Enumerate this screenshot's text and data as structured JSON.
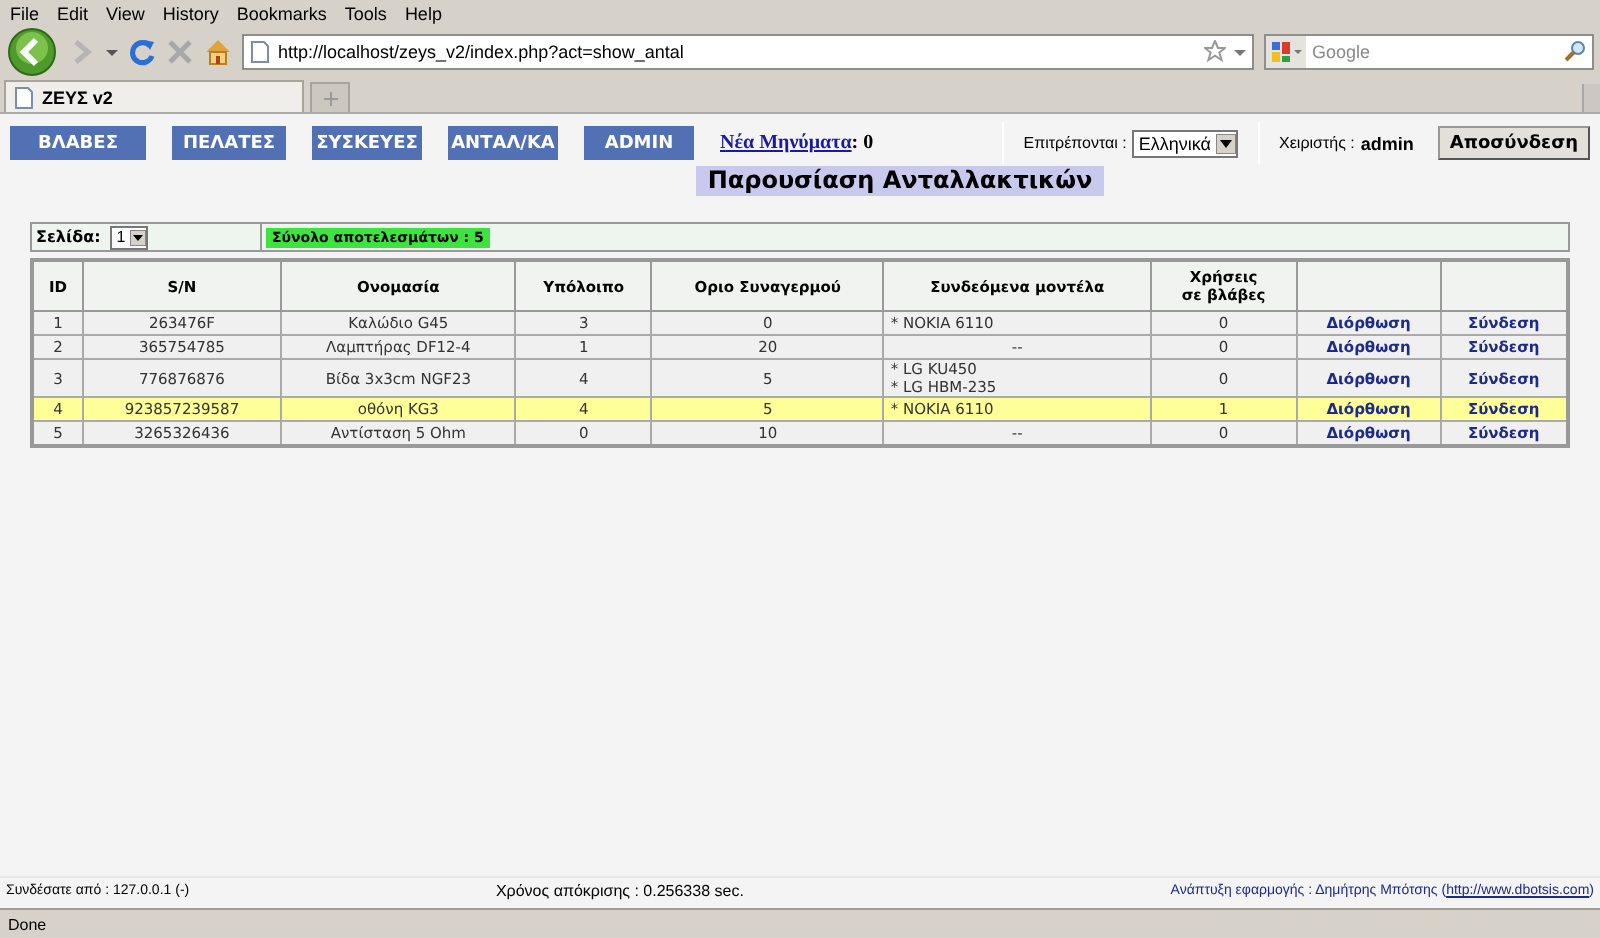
{
  "menu_bar": [
    "File",
    "Edit",
    "View",
    "History",
    "Bookmarks",
    "Tools",
    "Help"
  ],
  "address_bar": {
    "value": "http://localhost/zeys_v2/index.php?act=show_antal"
  },
  "search_box": {
    "placeholder": "Google"
  },
  "tabs": [
    {
      "label": "ΖΕΥΣ v2",
      "selected": true
    }
  ],
  "nav_buttons": [
    {
      "label": "ΒΛΑΒΕΣ"
    },
    {
      "label": "ΠΕΛΑΤΕΣ"
    },
    {
      "label": "ΣΥΣΚΕΥΕΣ"
    },
    {
      "label": "ΑΝΤΑΛ/ΚΑ"
    },
    {
      "label": "ADMIN"
    }
  ],
  "messages": {
    "link": "Νέα Μηνύματα",
    "count": ": 0"
  },
  "language": {
    "label": "Επιτρέπονται :",
    "value": "Ελληνικά"
  },
  "user": {
    "label": "Χειριστής :",
    "name": "admin"
  },
  "logout_button": "Αποσύνδεση",
  "page_title": "Παρουσίαση Ανταλλακτικών",
  "pager": {
    "label": "Σελίδα:",
    "value": "1"
  },
  "results_total": "Σύνολο αποτελεσμάτων : 5",
  "table": {
    "columns": [
      "ID",
      "S/N",
      "Ονομασία",
      "Υπόλοιπο",
      "Οριο Συναγερμού",
      "Συνδεόμενα μοντέλα",
      "Χρήσεις σε βλάβες"
    ],
    "rows": [
      {
        "id": "1",
        "sn": "263476F",
        "name": "Καλώδιο G45",
        "stock": "3",
        "alarm": "0",
        "models": [
          "* NOKIA 6110"
        ],
        "uses": "0",
        "edit": "Διόρθωση",
        "link": "Σύνδεση",
        "selected": false
      },
      {
        "id": "2",
        "sn": "365754785",
        "name": "Λαμπτήρας DF12-4",
        "stock": "1",
        "alarm": "20",
        "models": "--",
        "uses": "0",
        "edit": "Διόρθωση",
        "link": "Σύνδεση",
        "selected": false
      },
      {
        "id": "3",
        "sn": "776876876",
        "name": "Βίδα 3x3cm NGF23",
        "stock": "4",
        "alarm": "5",
        "models": [
          "* LG KU450",
          "* LG HBM-235"
        ],
        "uses": "0",
        "edit": "Διόρθωση",
        "link": "Σύνδεση",
        "selected": false
      },
      {
        "id": "4",
        "sn": "923857239587",
        "name": "οθόνη KG3",
        "stock": "4",
        "alarm": "5",
        "models": [
          "* NOKIA 6110"
        ],
        "uses": "1",
        "edit": "Διόρθωση",
        "link": "Σύνδεση",
        "selected": true
      },
      {
        "id": "5",
        "sn": "3265326436",
        "name": "Αντίσταση 5 Ohm",
        "stock": "0",
        "alarm": "10",
        "models": "--",
        "uses": "0",
        "edit": "Διόρθωση",
        "link": "Σύνδεση",
        "selected": false
      }
    ]
  },
  "footer": {
    "connection": "Συνδέσατε από : 127.0.0.1 (-)",
    "response_time": "Χρόνος απόκρισης : 0.256338 sec.",
    "credit": "Ανάπτυξη εφαρμογής : Δημήτρης Μπότσης (",
    "credit_link": "http://www.dbotsis.com",
    "credit_end": ")"
  },
  "status_bar": "Done"
}
